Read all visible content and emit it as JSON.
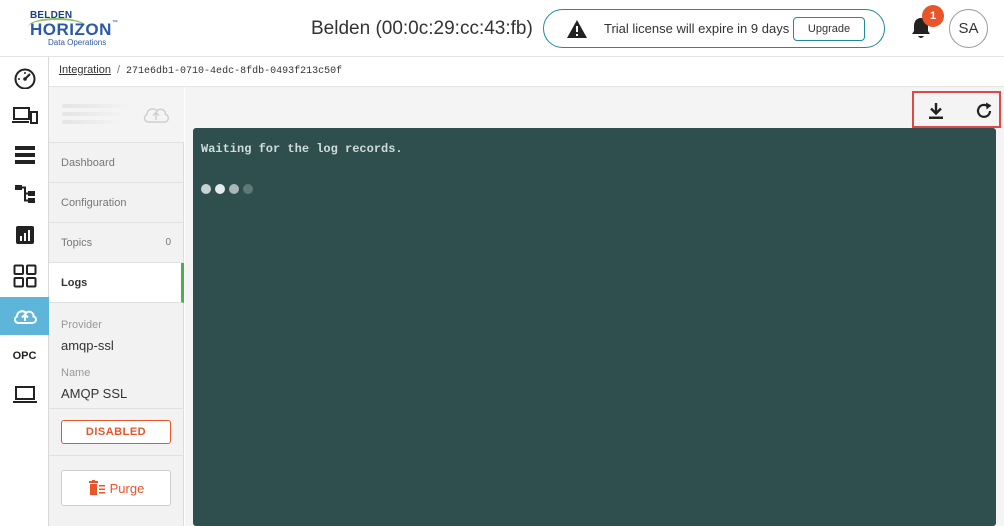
{
  "header": {
    "logo": {
      "line1": "BELDEN",
      "line2": "HORIZON",
      "tm": "™",
      "line3": "Data Operations"
    },
    "device_title": "Belden (00:0c:29:cc:43:fb)",
    "trial_message": "Trial license will expire in 9 days",
    "upgrade_label": "Upgrade",
    "notification_count": "1",
    "avatar_initials": "SA"
  },
  "rail": {
    "items": [
      {
        "icon": "speedometer-icon"
      },
      {
        "icon": "devices-icon"
      },
      {
        "icon": "list-icon"
      },
      {
        "icon": "hierarchy-icon"
      },
      {
        "icon": "chart-icon"
      },
      {
        "icon": "grid-icon"
      },
      {
        "icon": "cloud-upload-icon",
        "active": true
      },
      {
        "icon": "opc",
        "label": "OPC"
      },
      {
        "icon": "laptop-icon"
      }
    ]
  },
  "breadcrumb": {
    "root": "Integration",
    "separator": "/",
    "current": "271e6db1-0710-4edc-8fdb-0493f213c50f"
  },
  "panel": {
    "nav": [
      {
        "label": "Dashboard"
      },
      {
        "label": "Configuration"
      },
      {
        "label": "Topics",
        "count": "0"
      },
      {
        "label": "Logs",
        "active": true
      }
    ],
    "provider_label": "Provider",
    "provider_value": "amqp-ssl",
    "name_label": "Name",
    "name_value": "AMQP SSL",
    "status": "DISABLED",
    "purge_label": "Purge"
  },
  "main": {
    "console_text": "Waiting for the log records."
  },
  "colors": {
    "accent": "#5db6d9",
    "console_bg": "#2f4f4f",
    "danger": "#e8552b",
    "active_tab_border": "#4caf50",
    "highlight_box": "#e04848"
  }
}
